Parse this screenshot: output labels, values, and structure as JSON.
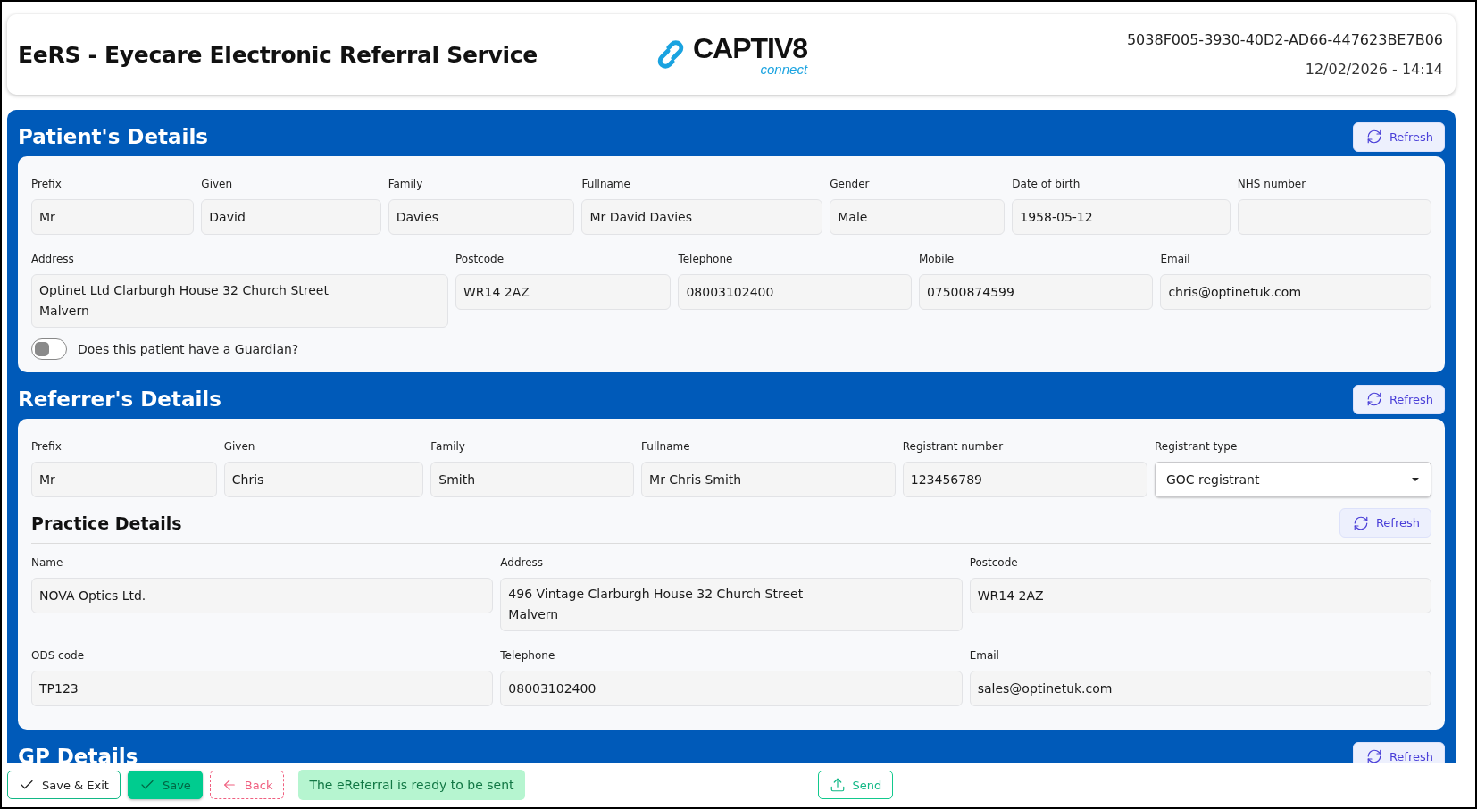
{
  "header": {
    "title": "EeRS - Eyecare Electronic Referral Service",
    "logo": {
      "name": "CAPTIV8",
      "tagline": "connect"
    },
    "reference": "5038F005-3930-40D2-AD66-447623BE7B06",
    "datetime": "12/02/2026 - 14:14"
  },
  "sections": [
    {
      "title": "Patient's Details",
      "refresh": "Refresh",
      "groups": [
        {
          "fields": [
            {
              "label": "Prefix",
              "value": "Mr",
              "kind": "text"
            },
            {
              "label": "Given",
              "value": "David",
              "kind": "text"
            },
            {
              "label": "Family",
              "value": "Davies",
              "kind": "text"
            },
            {
              "label": "Fullname",
              "value": "Mr David Davies",
              "kind": "text"
            },
            {
              "label": "Gender",
              "value": "Male",
              "kind": "text"
            },
            {
              "label": "Date of birth",
              "value": "1958-05-12",
              "kind": "text"
            },
            {
              "label": "NHS number",
              "kind": "text"
            }
          ]
        },
        {
          "fields": [
            {
              "label": "Address",
              "value": "Optinet Ltd Clarburgh House 32 Church Street\nMalvern",
              "kind": "textarea"
            },
            {
              "label": "Postcode",
              "value": "WR14 2AZ",
              "kind": "text"
            },
            {
              "label": "Telephone",
              "value": "08003102400",
              "kind": "text"
            },
            {
              "label": "Mobile",
              "value": "07500874599",
              "kind": "text"
            },
            {
              "label": "Email",
              "value": "chris@optinetuk.com",
              "kind": "text"
            }
          ]
        }
      ],
      "toggle": {
        "label": "Does this patient have a Guardian?",
        "on": false
      }
    },
    {
      "title": "Referrer's Details",
      "refresh": "Refresh",
      "groups": [
        {
          "fields": [
            {
              "label": "Prefix",
              "value": "Mr",
              "kind": "text"
            },
            {
              "label": "Given",
              "value": "Chris",
              "kind": "text"
            },
            {
              "label": "Family",
              "value": "Smith",
              "kind": "text"
            },
            {
              "label": "Fullname",
              "value": "Mr Chris Smith",
              "kind": "text"
            },
            {
              "label": "Registrant number",
              "value": "123456789",
              "kind": "text"
            },
            {
              "label": "Registrant type",
              "value": "GOC registrant",
              "kind": "select"
            }
          ]
        }
      ],
      "subsection": {
        "title": "Practice Details",
        "refresh": "Refresh",
        "groups": [
          {
            "fields": [
              {
                "label": "Name",
                "value": "NOVA Optics Ltd.",
                "kind": "text"
              },
              {
                "label": "Address",
                "value": "496 Vintage Clarburgh House 32 Church Street\nMalvern",
                "kind": "textarea"
              },
              {
                "label": "Postcode",
                "value": "WR14 2AZ",
                "kind": "text"
              }
            ]
          },
          {
            "fields": [
              {
                "label": "ODS code",
                "value": "TP123",
                "kind": "text"
              },
              {
                "label": "Telephone",
                "value": "08003102400",
                "kind": "text"
              },
              {
                "label": "Email",
                "value": "sales@optinetuk.com",
                "kind": "text"
              }
            ]
          }
        ]
      }
    },
    {
      "title": "GP Details",
      "refresh": "Refresh"
    }
  ],
  "footer": {
    "actions": [
      {
        "label": "Save & Exit",
        "kind": "outline"
      },
      {
        "label": "Save",
        "kind": "filled"
      },
      {
        "label": "Back",
        "kind": "dashed"
      }
    ],
    "status": "The eReferral is ready to be sent",
    "send": {
      "label": "Send",
      "kind": "outline-green"
    }
  }
}
